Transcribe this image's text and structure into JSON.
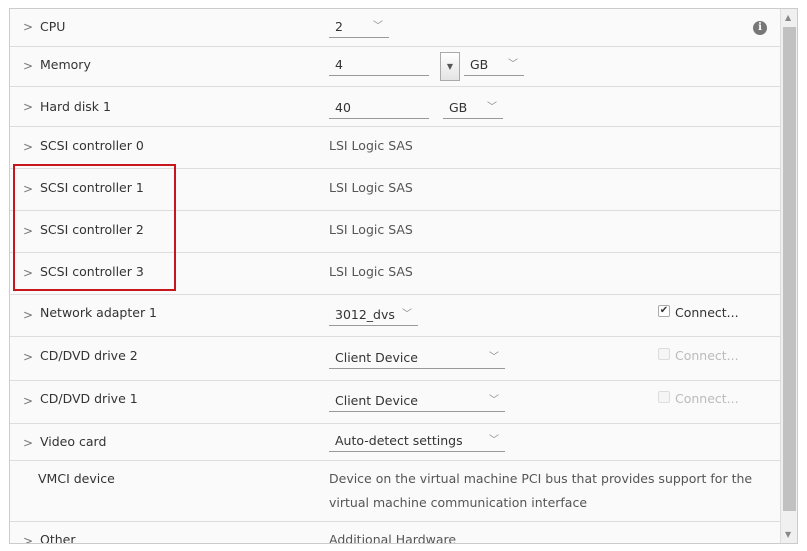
{
  "rows": {
    "cpu": {
      "label": "CPU",
      "value": "2"
    },
    "memory": {
      "label": "Memory",
      "value": "4",
      "unit": "GB"
    },
    "hdd": {
      "label": "Hard disk 1",
      "value": "40",
      "unit": "GB"
    },
    "scsi0": {
      "label": "SCSI controller 0",
      "value": "LSI Logic SAS"
    },
    "scsi1": {
      "label": "SCSI controller 1",
      "value": "LSI Logic SAS"
    },
    "scsi2": {
      "label": "SCSI controller 2",
      "value": "LSI Logic SAS"
    },
    "scsi3": {
      "label": "SCSI controller 3",
      "value": "LSI Logic SAS"
    },
    "net": {
      "label": "Network adapter 1",
      "value": "3012_dvs",
      "connect": "Connect...",
      "connected": true
    },
    "cd2": {
      "label": "CD/DVD drive 2",
      "value": "Client Device",
      "connect": "Connect...",
      "connected": false
    },
    "cd1": {
      "label": "CD/DVD drive 1",
      "value": "Client Device",
      "connect": "Connect...",
      "connected": false
    },
    "video": {
      "label": "Video card",
      "value": "Auto-detect settings"
    },
    "vmci": {
      "label": "VMCI device",
      "line1": "Device on the virtual machine PCI bus that provides support for the",
      "line2": "virtual machine communication interface"
    },
    "other": {
      "label": "Other",
      "value": "Additional Hardware"
    }
  },
  "colors": {
    "highlight": "#c8161d"
  }
}
